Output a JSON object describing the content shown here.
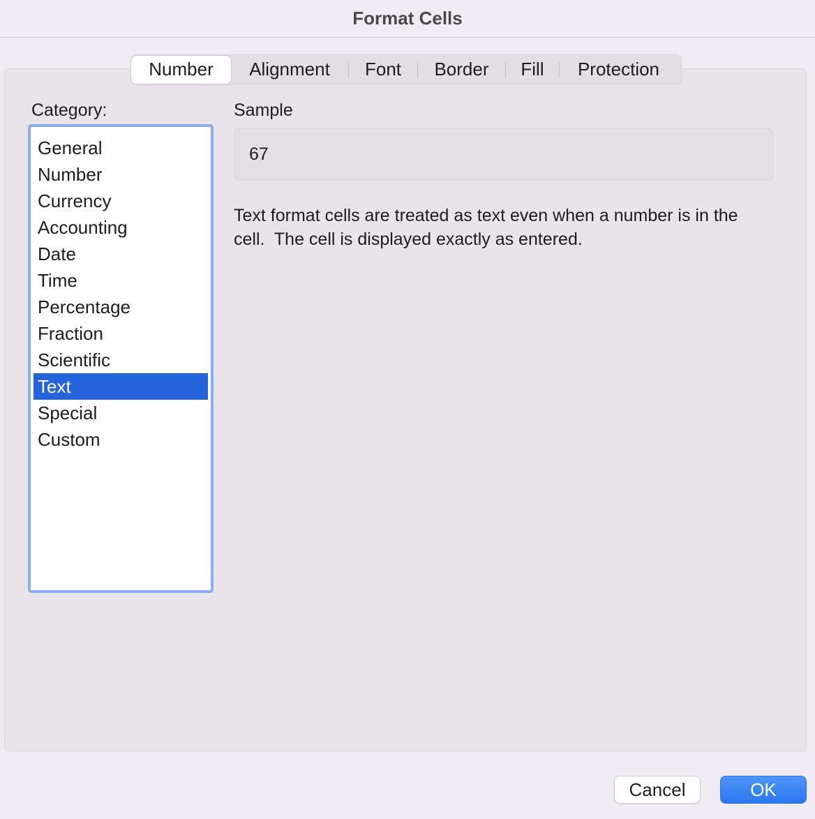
{
  "window": {
    "title": "Format Cells"
  },
  "tabs": [
    {
      "label": "Number",
      "active": true
    },
    {
      "label": "Alignment",
      "active": false
    },
    {
      "label": "Font",
      "active": false
    },
    {
      "label": "Border",
      "active": false
    },
    {
      "label": "Fill",
      "active": false
    },
    {
      "label": "Protection",
      "active": false
    }
  ],
  "category": {
    "label": "Category:",
    "items": [
      "General",
      "Number",
      "Currency",
      "Accounting",
      "Date",
      "Time",
      "Percentage",
      "Fraction",
      "Scientific",
      "Text",
      "Special",
      "Custom"
    ],
    "selected": "Text"
  },
  "sample": {
    "label": "Sample",
    "value": "67"
  },
  "description": "Text format cells are treated as text even when a number is in the cell.  The cell is displayed exactly as entered.",
  "buttons": {
    "cancel": "Cancel",
    "ok": "OK"
  },
  "colors": {
    "selection": "#2463d9",
    "list_focus_ring": "#8bacef",
    "ok_button": "#2a78f0"
  }
}
